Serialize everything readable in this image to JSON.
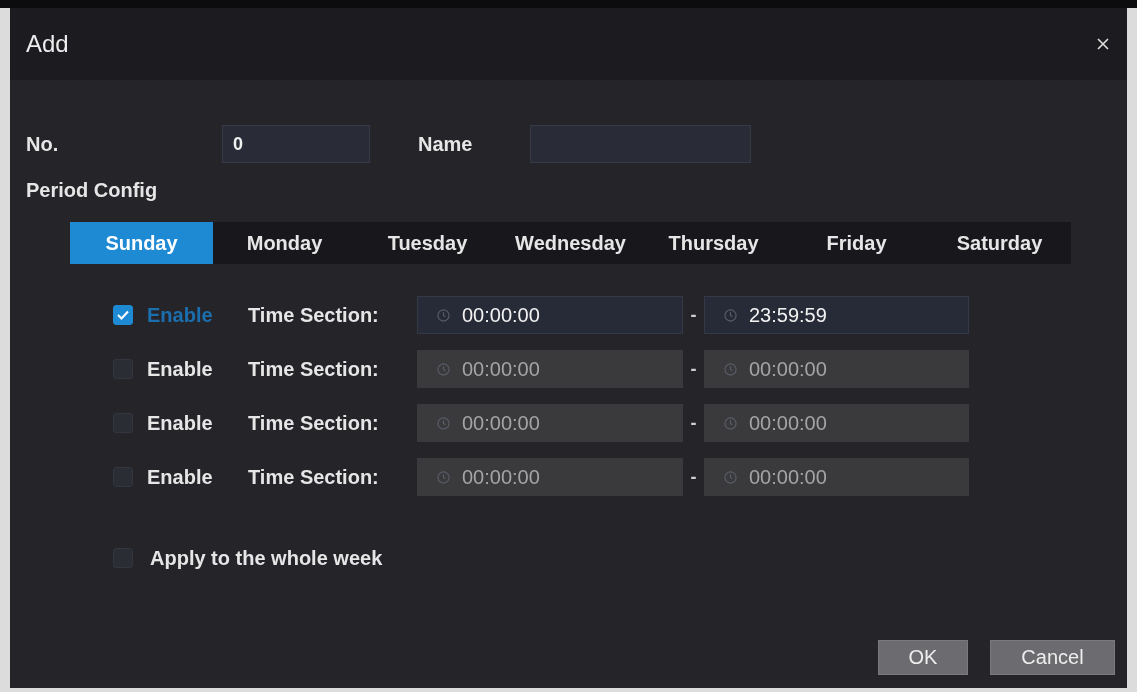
{
  "dialog": {
    "title": "Add"
  },
  "fields": [
    {
      "label": "No.",
      "value": "0"
    },
    {
      "label": "Name"
    }
  ],
  "period_config": {
    "label": "Period Config",
    "tabs": [
      {
        "label": "Sunday",
        "selected": true
      },
      {
        "label": "Monday",
        "selected": false
      },
      {
        "label": "Tuesday",
        "selected": false
      },
      {
        "label": "Wednesday",
        "selected": false
      },
      {
        "label": "Thursday",
        "selected": false
      },
      {
        "label": "Friday",
        "selected": false
      },
      {
        "label": "Saturday",
        "selected": false
      }
    ],
    "sections": [
      {
        "enable_label": "Enable",
        "checked": true,
        "label": "Time Section:",
        "start": "00:00:00",
        "separator": "-",
        "end": "23:59:59"
      },
      {
        "enable_label": "Enable",
        "checked": false,
        "label": "Time Section:",
        "start": "00:00:00",
        "separator": "-",
        "end": "00:00:00"
      },
      {
        "enable_label": "Enable",
        "checked": false,
        "label": "Time Section:",
        "start": "00:00:00",
        "separator": "-",
        "end": "00:00:00"
      },
      {
        "enable_label": "Enable",
        "checked": false,
        "label": "Time Section:",
        "start": "00:00:00",
        "separator": "-",
        "end": "00:00:00"
      }
    ],
    "apply_week": {
      "label": "Apply to the whole week",
      "checked": false
    }
  },
  "buttons": [
    {
      "label": "OK"
    },
    {
      "label": "Cancel"
    }
  ]
}
